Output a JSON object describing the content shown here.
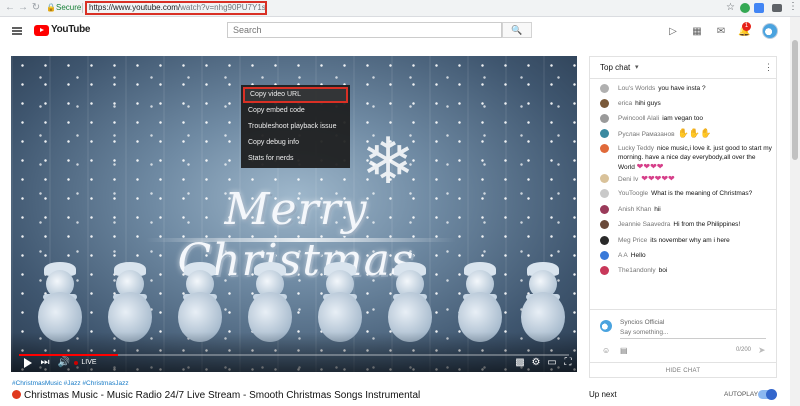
{
  "browser": {
    "secure_label": "Secure",
    "url_main": "https://www.youtube.com/",
    "url_rest": "watch?v=nhg90PU7Y1s"
  },
  "header": {
    "wordmark": "YouTube",
    "search_placeholder": "Search",
    "notification_count": "1"
  },
  "context_menu": {
    "items": [
      "Copy video URL",
      "Copy embed code",
      "Troubleshoot playback issue",
      "Copy debug info",
      "Stats for nerds"
    ]
  },
  "player": {
    "art_title": "Merry Christmas",
    "live_label": "LIVE",
    "progress": 0.18
  },
  "video": {
    "hashtags": "#ChristmasMusic #Jazz #ChristmasJazz",
    "title": "Christmas Music - Music Radio 24/7 Live Stream - Smooth Christmas Songs Instrumental"
  },
  "chat": {
    "title": "Top chat",
    "messages": [
      {
        "author": "Lou's Worlds",
        "text": "you have insta ?",
        "color": "#b0b0b0"
      },
      {
        "author": "erica",
        "text": "hihi guys",
        "color": "#7a5a3a"
      },
      {
        "author": "Pwincooll Alali",
        "text": "iam vegan too",
        "color": "#9a9a9a"
      },
      {
        "author": "Руслан Рамазанов",
        "text": "✋✋✋",
        "color": "#3b8aa0"
      },
      {
        "author": "Lucky Teddy",
        "text": "nice music,i love it. just good to start my morning. have a nice day everybody,all over the World",
        "color": "#e06a3a"
      },
      {
        "author": "Deni Iv",
        "text": "",
        "color": "#d9c29a"
      },
      {
        "author": "YouToogle",
        "text": "What is the meaning of Christmas?",
        "color": "#c9c9c9"
      },
      {
        "author": "Anish Khan",
        "text": "hii",
        "color": "#9a3a5a"
      },
      {
        "author": "Jeannie Saavedra",
        "text": "Hi from the Philippines!",
        "color": "#6a4a3a"
      },
      {
        "author": "Meg Price",
        "text": "its november why am i here",
        "color": "#2a2a2a"
      },
      {
        "author": "A A",
        "text": "Hello",
        "color": "#3a7ad9"
      },
      {
        "author": "The1andonly",
        "text": "boi",
        "color": "#c8385a"
      }
    ],
    "me_name": "Syncios Official",
    "input_placeholder": "Say something...",
    "char_count": "0/200",
    "hide_chat": "HIDE CHAT"
  },
  "sidebar": {
    "up_next": "Up next",
    "autoplay": "AUTOPLAY"
  }
}
